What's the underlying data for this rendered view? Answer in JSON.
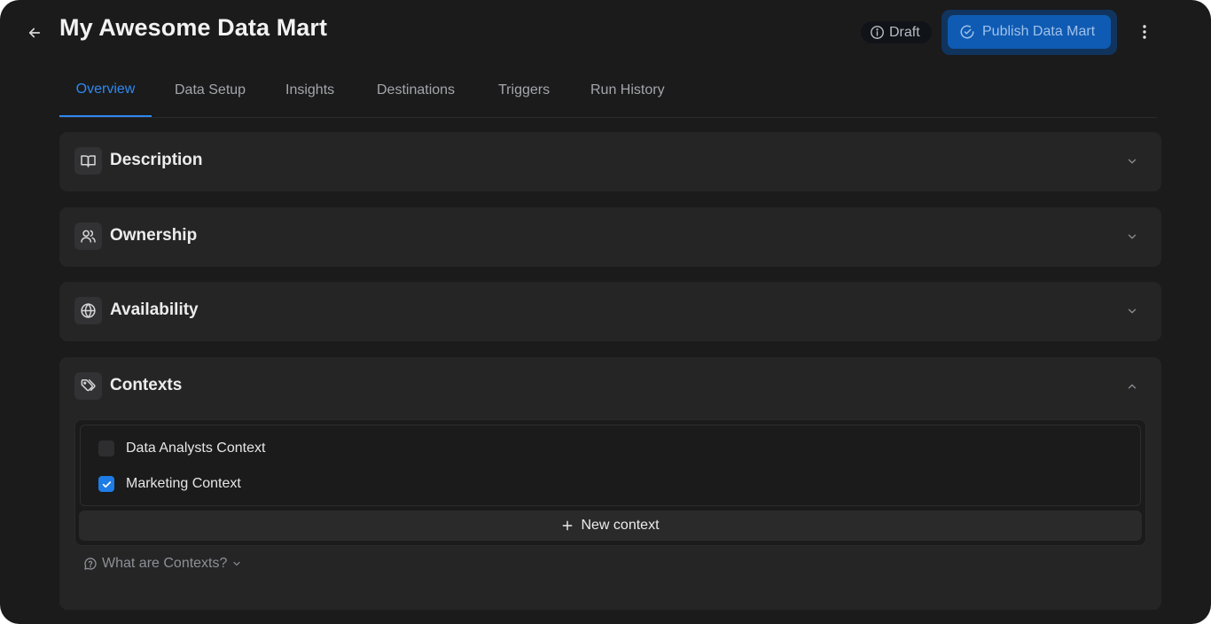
{
  "header": {
    "title": "My Awesome Data Mart",
    "status_badge": "Draft",
    "publish_label": "Publish Data Mart"
  },
  "tabs": [
    {
      "label": "Overview",
      "active": true
    },
    {
      "label": "Data Setup"
    },
    {
      "label": "Insights"
    },
    {
      "label": "Destinations"
    },
    {
      "label": "Triggers"
    },
    {
      "label": "Run History"
    }
  ],
  "sections": {
    "description": {
      "title": "Description",
      "icon": "book-open-icon",
      "expanded": false
    },
    "ownership": {
      "title": "Ownership",
      "icon": "users-icon",
      "expanded": false
    },
    "availability": {
      "title": "Availability",
      "icon": "globe-icon",
      "expanded": false
    },
    "contexts": {
      "title": "Contexts",
      "icon": "tags-icon",
      "expanded": true
    }
  },
  "contexts": {
    "items": [
      {
        "label": "Data Analysts Context",
        "checked": false
      },
      {
        "label": "Marketing Context",
        "checked": true
      }
    ],
    "new_label": "New context",
    "help_label": "What are Contexts?"
  },
  "colors": {
    "background": "#1b1b1c",
    "card": "#252526",
    "accent": "#2e89f0",
    "publish": "#0f5bb3"
  }
}
